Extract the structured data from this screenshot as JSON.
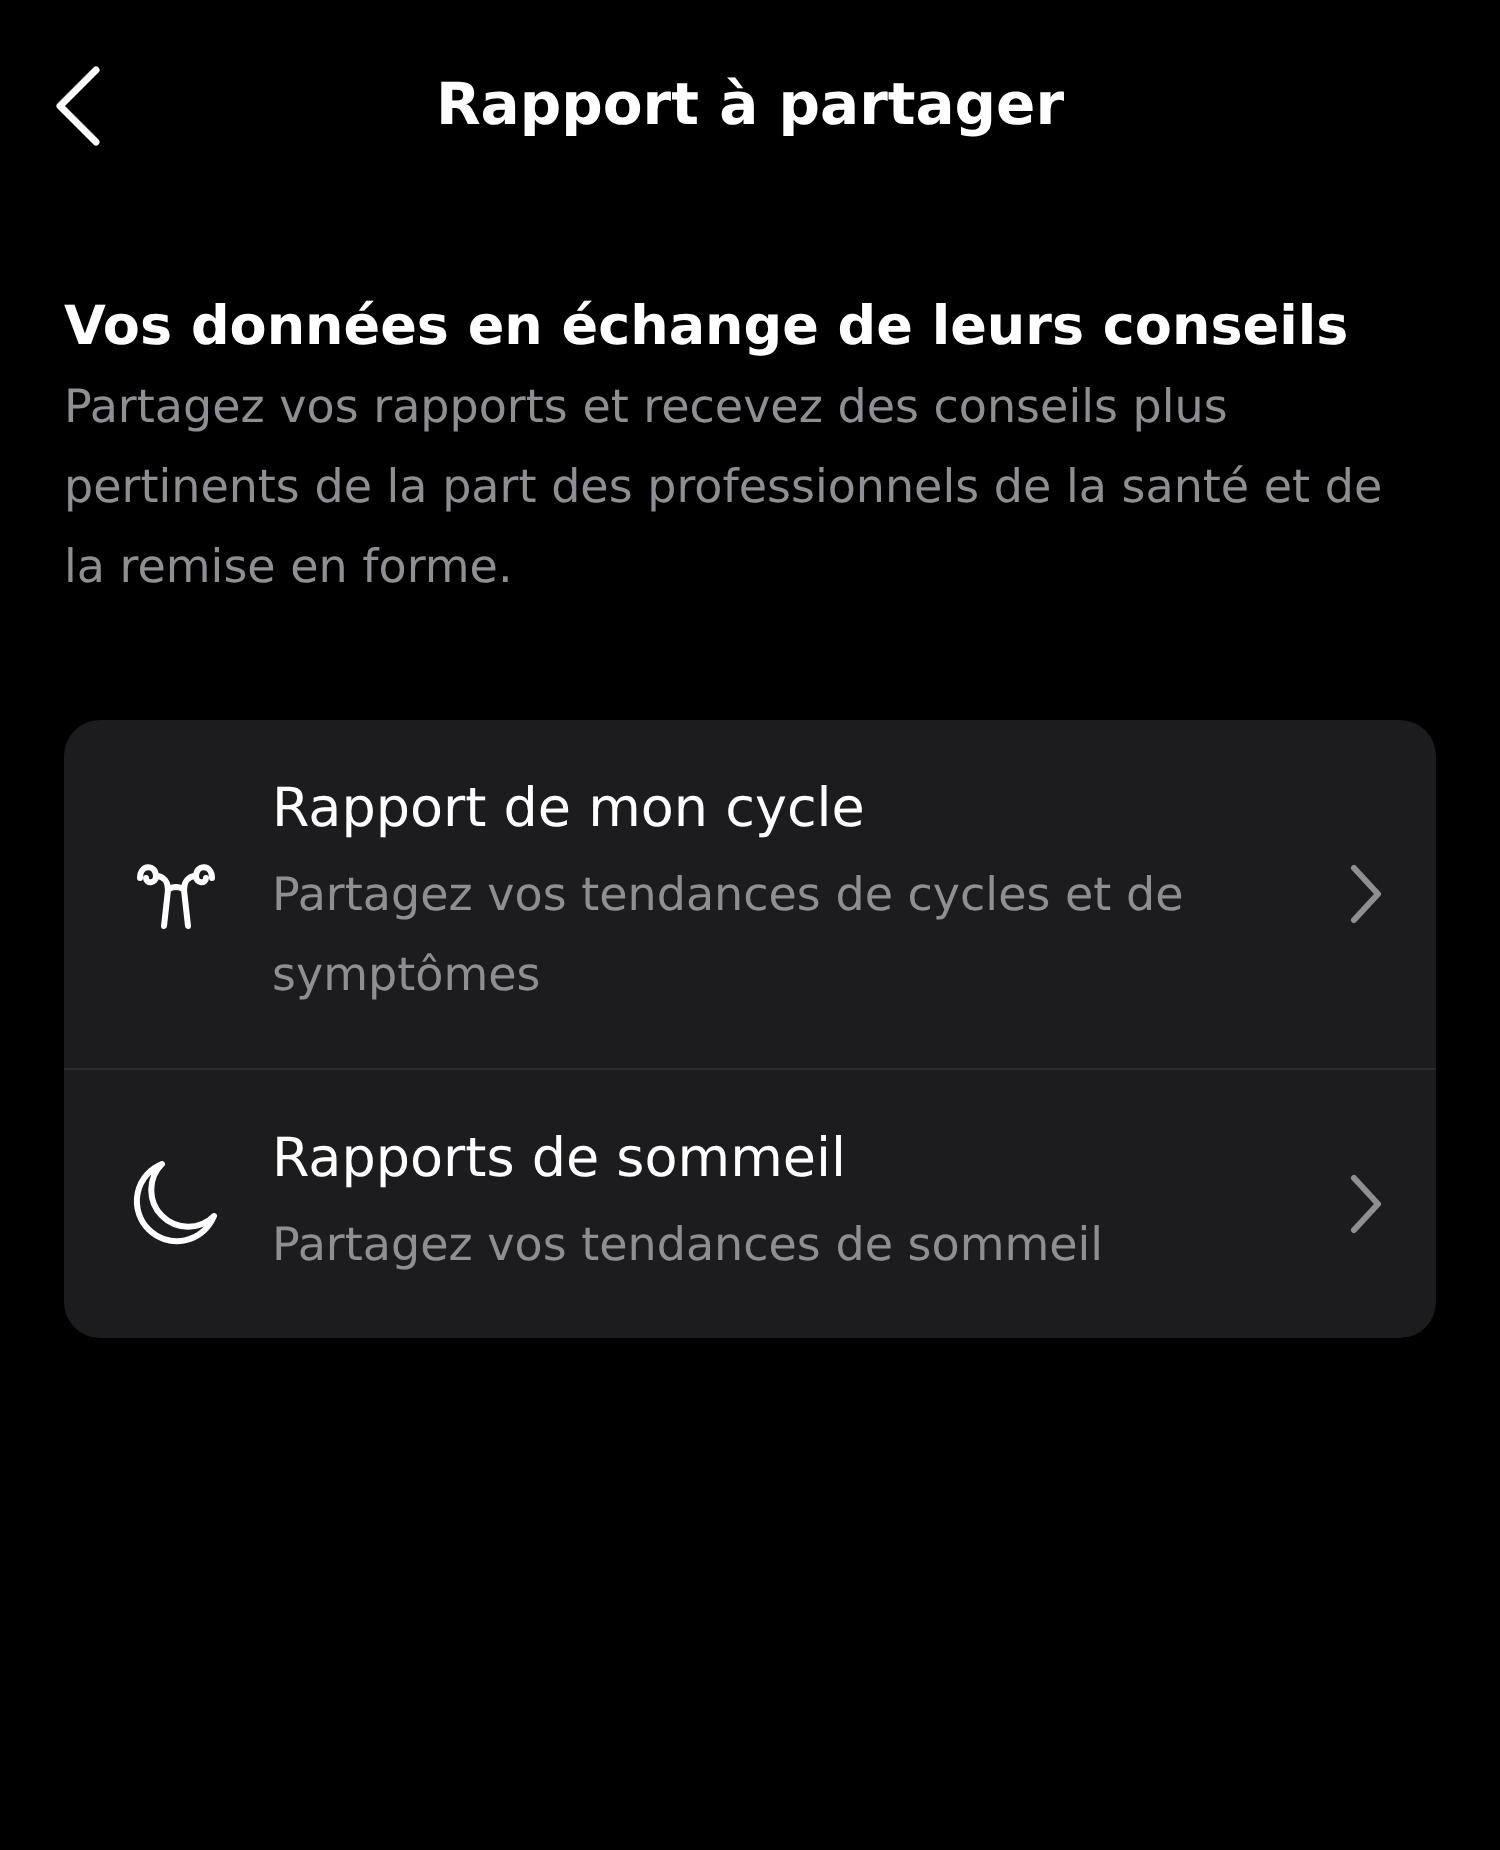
{
  "header": {
    "title": "Rapport à partager"
  },
  "intro": {
    "heading": "Vos données en échange de leurs conseils",
    "description": "Partagez vos rapports et recevez des conseils plus pertinents de la part des professionnels de la santé et de la remise en forme."
  },
  "reports": [
    {
      "kind": "cycle",
      "title": "Rapport de mon cycle",
      "subtitle": "Partagez vos tendances de cycles et de symptômes"
    },
    {
      "kind": "sleep",
      "title": "Rapports de sommeil",
      "subtitle": "Partagez vos tendances de sommeil"
    }
  ]
}
